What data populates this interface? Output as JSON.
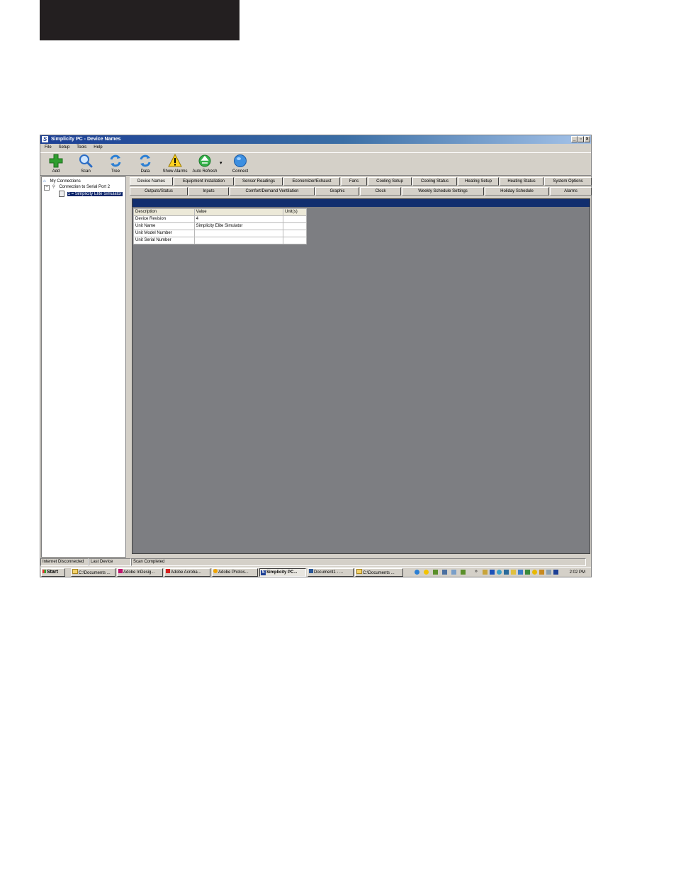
{
  "window": {
    "title": "Simplicity PC - Device Names",
    "logo_letter": "S",
    "colors": {
      "titlebar": "#1c3f95",
      "content_bg": "#7d7e82",
      "content_header": "#112e6e",
      "selection": "#0a246a"
    }
  },
  "menu": [
    "File",
    "Setup",
    "Tools",
    "Help"
  ],
  "toolbar": [
    {
      "label": "Add",
      "icon": "add-icon"
    },
    {
      "label": "Scan",
      "icon": "magnifier-icon"
    },
    {
      "label": "Tree",
      "icon": "refresh-icon"
    },
    {
      "label": "Data",
      "icon": "refresh-icon"
    },
    {
      "label": "Show Alarms",
      "icon": "warning-icon"
    },
    {
      "label": "Auto Refresh",
      "icon": "recycle-icon"
    },
    {
      "label": "Connect",
      "icon": "globe-icon"
    }
  ],
  "tree": {
    "root": "My Connections",
    "connection": "Connection to Serial Port 2",
    "device": "1 = Simplicity Elite Simulator"
  },
  "tabs_row1": [
    "Device Names",
    "Equipment Installation",
    "Sensor Readings",
    "Economizer/Exhaust",
    "Fans",
    "Cooling Setup",
    "Cooling Status",
    "Heating Setup",
    "Heating Status",
    "System Options"
  ],
  "tabs_row2": [
    "Outputs/Status",
    "Inputs",
    "Comfort/Demand Ventilation",
    "Graphic",
    "Clock",
    "Weekly Schedule Settings",
    "Holiday Schedule",
    "Alarms"
  ],
  "grid": {
    "headers": [
      "Description",
      "Value",
      "Unit(s)"
    ],
    "rows": [
      [
        "Device Revision",
        "4",
        ""
      ],
      [
        "Unit Name",
        "Simplicity Elite Simulator",
        ""
      ],
      [
        "Unit Model Number",
        "",
        ""
      ],
      [
        "Unit Serial Number",
        "",
        ""
      ]
    ]
  },
  "status": [
    "Internet Disconnected",
    "Last Device",
    "Scan Completed"
  ],
  "taskbar": {
    "start": "Start",
    "tasks": [
      "C:\\Documents ...",
      "Adobe InDesig...",
      "Adobe Acroba...",
      "Adobe Photos...",
      "Simplicity PC...",
      "Document1 - ...",
      "C:\\Documents ..."
    ],
    "chevron": "»",
    "clock": "2:02 PM"
  }
}
